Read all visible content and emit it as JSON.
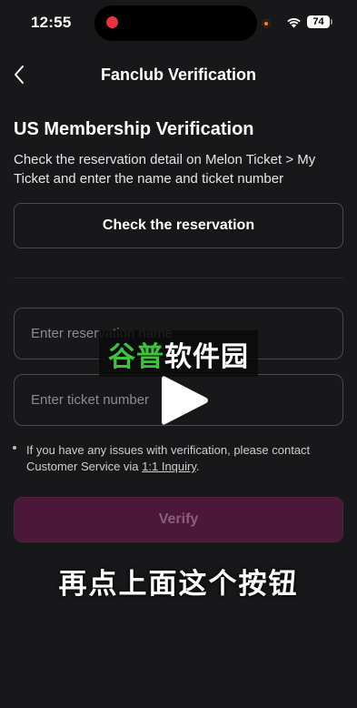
{
  "status_bar": {
    "time": "12:55",
    "battery": "74",
    "icons": [
      "recording-dot-icon",
      "wifi-icon",
      "battery-icon"
    ]
  },
  "nav": {
    "title": "Fanclub Verification",
    "back_icon": "chevron-left-icon"
  },
  "main": {
    "section_title": "US Membership Verification",
    "description": "Check the reservation detail on Melon Ticket > My Ticket and enter the name and ticket number",
    "check_button_label": "Check the reservation",
    "name_field": {
      "value": "",
      "placeholder": "Enter reservation name"
    },
    "ticket_field": {
      "value": "",
      "placeholder": "Enter ticket number"
    },
    "note_prefix": "If you have any issues with verification, please contact Customer Service via ",
    "note_link": "1:1 Inquiry",
    "note_suffix": ".",
    "verify_button_label": "Verify"
  },
  "overlay": {
    "watermark_green": "谷普",
    "watermark_white": "软件园",
    "caption": "再点上面这个按钮",
    "play_icon": "play-icon"
  },
  "colors": {
    "background": "#18171a",
    "verify_button_bg": "#4a1838",
    "verify_button_text": "#8c5f7b",
    "recording_dot": "#e8323c",
    "watermark_green": "#3ec33c"
  }
}
